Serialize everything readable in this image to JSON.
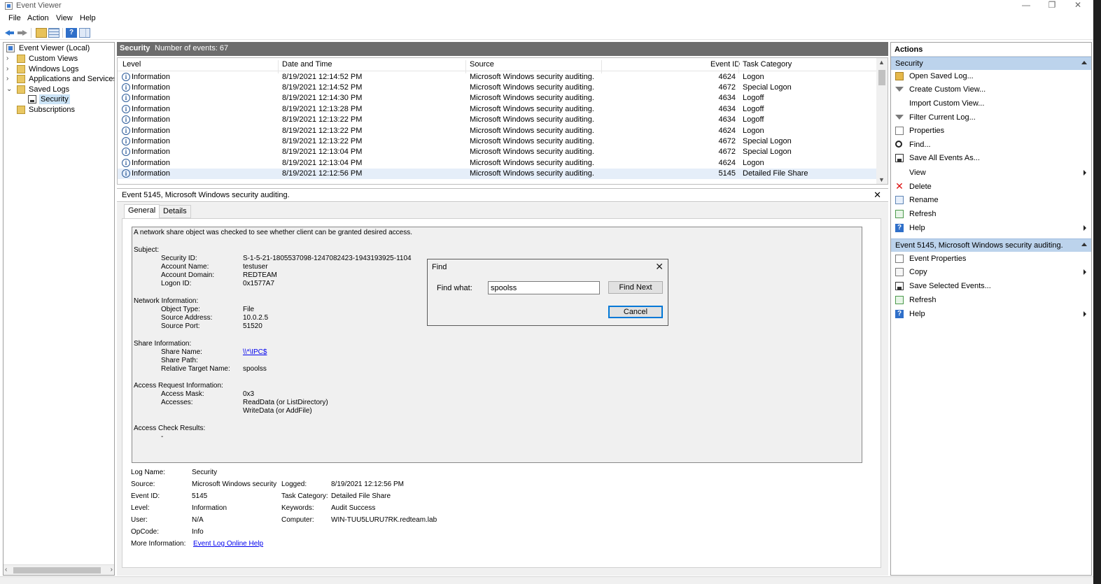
{
  "window": {
    "title": "Event Viewer",
    "minimize": "—",
    "restore": "❐",
    "close": "✕"
  },
  "menu": [
    "File",
    "Action",
    "View",
    "Help"
  ],
  "toolbar": {
    "help_glyph": "?"
  },
  "tree": {
    "items": [
      {
        "label": "Event Viewer (Local)",
        "expander": ""
      },
      {
        "label": "Custom Views",
        "expander": "›"
      },
      {
        "label": "Windows Logs",
        "expander": "›"
      },
      {
        "label": "Applications and Services Lo",
        "expander": "›"
      },
      {
        "label": "Saved Logs",
        "expander": "⌄"
      },
      {
        "label": "Security",
        "expander": ""
      },
      {
        "label": "Subscriptions",
        "expander": ""
      }
    ],
    "scroll_left": "‹",
    "scroll_right": "›"
  },
  "log": {
    "name": "Security",
    "count": "Number of events: 67",
    "columns": {
      "level": "Level",
      "date": "Date and Time",
      "source": "Source",
      "event_id": "Event ID",
      "task": "Task Category"
    },
    "info_glyph": "i",
    "rows": [
      {
        "level": "Information",
        "date": "8/19/2021 12:14:52 PM",
        "source": "Microsoft Windows security auditing.",
        "id": "4624",
        "task": "Logon"
      },
      {
        "level": "Information",
        "date": "8/19/2021 12:14:52 PM",
        "source": "Microsoft Windows security auditing.",
        "id": "4672",
        "task": "Special Logon"
      },
      {
        "level": "Information",
        "date": "8/19/2021 12:14:30 PM",
        "source": "Microsoft Windows security auditing.",
        "id": "4634",
        "task": "Logoff"
      },
      {
        "level": "Information",
        "date": "8/19/2021 12:13:28 PM",
        "source": "Microsoft Windows security auditing.",
        "id": "4634",
        "task": "Logoff"
      },
      {
        "level": "Information",
        "date": "8/19/2021 12:13:22 PM",
        "source": "Microsoft Windows security auditing.",
        "id": "4634",
        "task": "Logoff"
      },
      {
        "level": "Information",
        "date": "8/19/2021 12:13:22 PM",
        "source": "Microsoft Windows security auditing.",
        "id": "4624",
        "task": "Logon"
      },
      {
        "level": "Information",
        "date": "8/19/2021 12:13:22 PM",
        "source": "Microsoft Windows security auditing.",
        "id": "4672",
        "task": "Special Logon"
      },
      {
        "level": "Information",
        "date": "8/19/2021 12:13:04 PM",
        "source": "Microsoft Windows security auditing.",
        "id": "4672",
        "task": "Special Logon"
      },
      {
        "level": "Information",
        "date": "8/19/2021 12:13:04 PM",
        "source": "Microsoft Windows security auditing.",
        "id": "4624",
        "task": "Logon"
      },
      {
        "level": "Information",
        "date": "8/19/2021 12:12:56 PM",
        "source": "Microsoft Windows security auditing.",
        "id": "5145",
        "task": "Detailed File Share"
      }
    ],
    "scroll_up": "▲",
    "scroll_down": "▼"
  },
  "detail": {
    "title": "Event 5145, Microsoft Windows security auditing.",
    "close": "✕",
    "tabs": [
      "General",
      "Details"
    ],
    "message": {
      "intro": "A network share object was checked to see whether client can be granted desired access.",
      "subject_h": "Subject:",
      "security_id_l": "Security ID:",
      "security_id": "S-1-5-21-1805537098-1247082423-1943193925-1104",
      "account_name_l": "Account Name:",
      "account_name": "testuser",
      "account_domain_l": "Account Domain:",
      "account_domain": "REDTEAM",
      "logon_id_l": "Logon ID:",
      "logon_id": "0x1577A7",
      "network_h": "Network Information:",
      "object_type_l": "Object Type:",
      "object_type": "File",
      "source_address_l": "Source Address:",
      "source_address": "10.0.2.5",
      "source_port_l": "Source Port:",
      "source_port": "51520",
      "share_h": "Share Information:",
      "share_name_l": "Share Name:",
      "share_name": "\\\\*\\IPC$",
      "share_path_l": "Share Path:",
      "rel_target_l": "Relative Target Name:",
      "rel_target": "spoolss",
      "access_h": "Access Request Information:",
      "access_mask_l": "Access Mask:",
      "access_mask": "0x3",
      "accesses_l": "Accesses:",
      "accesses_1": "ReadData (or ListDirectory)",
      "accesses_2": "WriteData (or AddFile)",
      "check_h": "Access Check Results:",
      "check_val": "-"
    },
    "meta": {
      "log_name_l": "Log Name:",
      "log_name": "Security",
      "source_l": "Source:",
      "source": "Microsoft Windows security",
      "logged_l": "Logged:",
      "logged": "8/19/2021 12:12:56 PM",
      "event_id_l": "Event ID:",
      "event_id": "5145",
      "task_l": "Task Category:",
      "task": "Detailed File Share",
      "level_l": "Level:",
      "level": "Information",
      "keywords_l": "Keywords:",
      "keywords": "Audit Success",
      "user_l": "User:",
      "user": "N/A",
      "computer_l": "Computer:",
      "computer": "WIN-TUU5LURU7RK.redteam.lab",
      "opcode_l": "OpCode:",
      "opcode": "Info",
      "more_l": "More Information:",
      "more_link": "Event Log Online Help"
    }
  },
  "find_dialog": {
    "title": "Find",
    "close": "✕",
    "label": "Find what:",
    "value": "spoolss",
    "find_next": "Find Next",
    "cancel": "Cancel"
  },
  "actions": {
    "title": "Actions",
    "section1": "Security",
    "items1": [
      {
        "label": "Open Saved Log...",
        "icon": "open-icon",
        "sub": false
      },
      {
        "label": "Create Custom View...",
        "icon": "filter-icon",
        "sub": false
      },
      {
        "label": "Import Custom View...",
        "icon": "",
        "sub": false
      },
      {
        "label": "Filter Current Log...",
        "icon": "filter-icon",
        "sub": false
      },
      {
        "label": "Properties",
        "icon": "properties-icon",
        "sub": false
      },
      {
        "label": "Find...",
        "icon": "find-icon",
        "sub": false
      },
      {
        "label": "Save All Events As...",
        "icon": "save-icon",
        "sub": false
      },
      {
        "label": "View",
        "icon": "",
        "sub": true
      },
      {
        "label": "Delete",
        "icon": "delete-icon",
        "sub": false
      },
      {
        "label": "Rename",
        "icon": "rename-icon",
        "sub": false
      },
      {
        "label": "Refresh",
        "icon": "refresh-icon",
        "sub": false
      },
      {
        "label": "Help",
        "icon": "help-icon",
        "sub": true
      }
    ],
    "section2": "Event 5145, Microsoft Windows security auditing.",
    "items2": [
      {
        "label": "Event Properties",
        "icon": "properties-icon",
        "sub": false
      },
      {
        "label": "Copy",
        "icon": "copy-icon",
        "sub": true
      },
      {
        "label": "Save Selected Events...",
        "icon": "save-icon",
        "sub": false
      },
      {
        "label": "Refresh",
        "icon": "refresh-icon",
        "sub": false
      },
      {
        "label": "Help",
        "icon": "help-icon",
        "sub": true
      }
    ],
    "delete_glyph": "✕",
    "help_glyph": "?"
  }
}
